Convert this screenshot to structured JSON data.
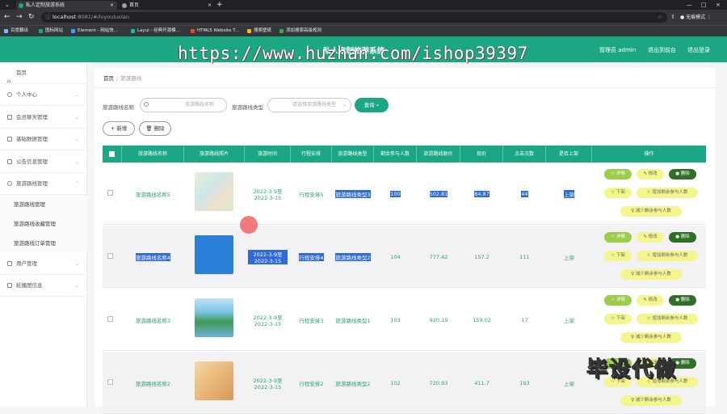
{
  "browser": {
    "tabs": [
      {
        "label": "私人定制旅游系统"
      },
      {
        "label": "首页"
      }
    ],
    "url_host": "localhost",
    "url_path": ":8081/#/lvyouluxian",
    "profile_label": "无痕模式",
    "bookmarks": [
      "百度翻译",
      "图标网站",
      "Element - 网站快...",
      "Layui - 经典开源模...",
      "HTML5 Website T...",
      "搜索壁纸",
      "添加搜索高级规则"
    ]
  },
  "header": {
    "site_title": "私人定制旅游系统",
    "admin_label": "管理员 admin",
    "front_label": "退出到前台",
    "logout_label": "退出登录"
  },
  "overlay": {
    "watermark": "https://www.huzhan.com/ishop39397",
    "bottom_text": "毕设代做"
  },
  "sidebar": {
    "items": [
      {
        "label": "首页"
      },
      {
        "label": "个人中心"
      },
      {
        "label": "会员聊天管理"
      },
      {
        "label": "基础数据管理"
      },
      {
        "label": "公告信息管理"
      },
      {
        "label": "旅游路线管理"
      },
      {
        "label": "用户管理"
      },
      {
        "label": "轮播图信息"
      }
    ],
    "subitems": [
      {
        "label": "旅游路线管理"
      },
      {
        "label": "旅游路线收藏管理"
      },
      {
        "label": "旅游路线订单管理"
      }
    ]
  },
  "breadcrumb": {
    "home": "首页",
    "sep": "/",
    "current": "旅游路线"
  },
  "filters": {
    "name_label": "旅游路线名称",
    "name_placeholder": "旅游路线名称",
    "type_label": "旅游路线类型",
    "type_placeholder": "请选择旅游路线类型",
    "search_button": "查询",
    "add_button": "+ 新增",
    "delete_button": "删除"
  },
  "table": {
    "headers": [
      "旅游路线名称",
      "旅游路线照片",
      "旅游时间",
      "行程安排",
      "旅游路线类型",
      "剩余参与人数",
      "旅游路线原价",
      "现价",
      "点击次数",
      "是否上架",
      "操作"
    ],
    "rows": [
      {
        "name": "旅游路线名称5",
        "time": "2022-3-9至2022-3-15",
        "plan": "行程安排5",
        "type": "旅游路线类型3",
        "remain": "100",
        "orig": "502.81",
        "price": "84.87",
        "clicks": "44",
        "status": "上架"
      },
      {
        "name": "旅游路线名称4",
        "time": "2022-3-9至2022-3-15",
        "plan": "行程安排4",
        "type": "旅游路线类型2",
        "remain": "104",
        "orig": "777.42",
        "price": "157.2",
        "clicks": "111",
        "status": "上架"
      },
      {
        "name": "旅游路线名称3",
        "time": "2022-3-9至2022-3-15",
        "plan": "行程安排3",
        "type": "旅游路线类型1",
        "remain": "103",
        "orig": "920.19",
        "price": "159.02",
        "clicks": "17",
        "status": "上架"
      },
      {
        "name": "旅游路线名称2",
        "time": "2022-3-9至2022-3-15",
        "plan": "行程安排2",
        "type": "旅游路线类型2",
        "remain": "102",
        "orig": "720.93",
        "price": "411.7",
        "clicks": "193",
        "status": "上架"
      }
    ],
    "actions": {
      "detail": "详情",
      "edit": "修改",
      "delete": "删除",
      "offshelf": "下架",
      "add_people": "增加剩余参与人数",
      "reduce_people": "减少剩余参与人数"
    }
  },
  "colors": {
    "primary": "#1ba784",
    "detail": "#9ccd4a",
    "yellow": "#f5f58e",
    "delete": "#2f6f28"
  }
}
